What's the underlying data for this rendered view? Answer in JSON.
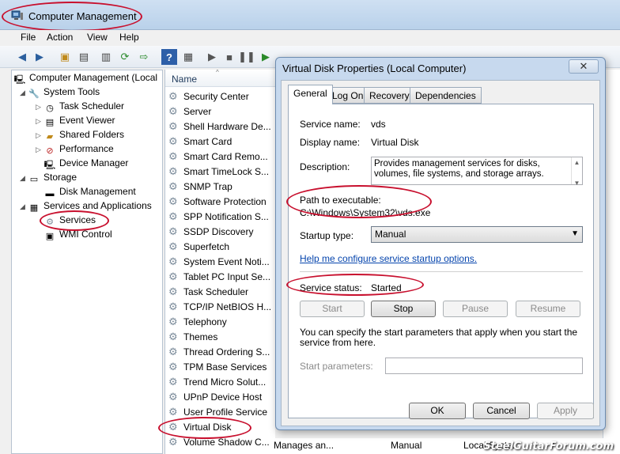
{
  "window": {
    "title": "Computer Management"
  },
  "menu": [
    "File",
    "Action",
    "View",
    "Help"
  ],
  "tree": {
    "items": [
      {
        "label": "Computer Management (Local",
        "level": 0,
        "arrow": ""
      },
      {
        "label": "System Tools",
        "level": 1,
        "arrow": "◢"
      },
      {
        "label": "Task Scheduler",
        "level": 2,
        "arrow": "▷"
      },
      {
        "label": "Event Viewer",
        "level": 2,
        "arrow": "▷"
      },
      {
        "label": "Shared Folders",
        "level": 2,
        "arrow": "▷"
      },
      {
        "label": "Performance",
        "level": 2,
        "arrow": "▷"
      },
      {
        "label": "Device Manager",
        "level": 2,
        "arrow": ""
      },
      {
        "label": "Storage",
        "level": 1,
        "arrow": "◢"
      },
      {
        "label": "Disk Management",
        "level": 2,
        "arrow": ""
      },
      {
        "label": "Services and Applications",
        "level": 1,
        "arrow": "◢"
      },
      {
        "label": "Services",
        "level": 2,
        "arrow": ""
      },
      {
        "label": "WMI Control",
        "level": 2,
        "arrow": ""
      }
    ]
  },
  "services": {
    "column_name": "Name",
    "rows": [
      "Security Center",
      "Server",
      "Shell Hardware De...",
      "Smart Card",
      "Smart Card Remo...",
      "Smart TimeLock S...",
      "SNMP Trap",
      "Software Protection",
      "SPP Notification S...",
      "SSDP Discovery",
      "Superfetch",
      "System Event Noti...",
      "Tablet PC Input Se...",
      "Task Scheduler",
      "TCP/IP NetBIOS H...",
      "Telephony",
      "Themes",
      "Thread Ordering S...",
      "TPM Base Services",
      "Trend Micro Solut...",
      "UPnP Device Host",
      "User Profile Service",
      "Virtual Disk",
      "Volume Shadow C..."
    ],
    "last_row": {
      "description": "Manages an...",
      "startup": "Manual",
      "logon": "Local Syste..."
    }
  },
  "dialog": {
    "title": "Virtual Disk Properties (Local Computer)",
    "close": "✕",
    "tabs": [
      "General",
      "Log On",
      "Recovery",
      "Dependencies"
    ],
    "service_name_label": "Service name:",
    "service_name": "vds",
    "display_name_label": "Display name:",
    "display_name": "Virtual Disk",
    "description_label": "Description:",
    "description": "Provides management services for disks, volumes, file systems, and storage arrays.",
    "path_label": "Path to executable:",
    "path": "C:\\Windows\\System32\\vds.exe",
    "startup_label": "Startup type:",
    "startup_value": "Manual",
    "help_link": "Help me configure service startup options.",
    "status_label": "Service status:",
    "status_value": "Started",
    "buttons": {
      "start": "Start",
      "stop": "Stop",
      "pause": "Pause",
      "resume": "Resume"
    },
    "params_note": "You can specify the start parameters that apply when you start the service from here.",
    "params_label": "Start parameters:",
    "ok": "OK",
    "cancel": "Cancel",
    "apply": "Apply"
  },
  "watermark": "SteelGuitarForum.com",
  "annotation_color": "#c8102e"
}
